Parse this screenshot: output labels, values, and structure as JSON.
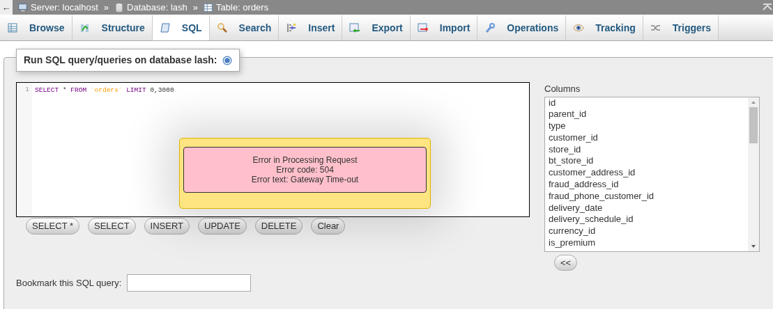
{
  "topbar": {
    "back": "←",
    "crumbs": [
      {
        "kind": "server",
        "label": "Server: localhost"
      },
      {
        "kind": "database",
        "label": "Database: lash"
      },
      {
        "kind": "table",
        "label": "Table: orders"
      }
    ],
    "separator": "»"
  },
  "tabs": [
    {
      "kind": "browse",
      "label": "Browse",
      "selected": false
    },
    {
      "kind": "structure",
      "label": "Structure",
      "selected": false
    },
    {
      "kind": "sql",
      "label": "SQL",
      "selected": true
    },
    {
      "kind": "search",
      "label": "Search",
      "selected": false
    },
    {
      "kind": "insert",
      "label": "Insert",
      "selected": false
    },
    {
      "kind": "export",
      "label": "Export",
      "selected": false
    },
    {
      "kind": "import",
      "label": "Import",
      "selected": false
    },
    {
      "kind": "operations",
      "label": "Operations",
      "selected": false
    },
    {
      "kind": "tracking",
      "label": "Tracking",
      "selected": false
    },
    {
      "kind": "triggers",
      "label": "Triggers",
      "selected": false
    }
  ],
  "legend": "Run SQL query/queries on database lash:",
  "editor": {
    "line_number": "1",
    "tokens": [
      {
        "text": "SELECT",
        "kind": "keyword"
      },
      {
        "text": "*",
        "kind": "plain"
      },
      {
        "text": "FROM",
        "kind": "keyword"
      },
      {
        "text": "`orders`",
        "kind": "identifier"
      },
      {
        "text": "LIMIT",
        "kind": "keyword"
      },
      {
        "text": "0,3000",
        "kind": "plain"
      }
    ]
  },
  "query_buttons": [
    "SELECT *",
    "SELECT",
    "INSERT",
    "UPDATE",
    "DELETE",
    "Clear"
  ],
  "columns": {
    "label": "Columns",
    "items": [
      "id",
      "parent_id",
      "type",
      "customer_id",
      "store_id",
      "bt_store_id",
      "customer_address_id",
      "fraud_address_id",
      "fraud_phone_customer_id",
      "delivery_date",
      "delivery_schedule_id",
      "currency_id",
      "is_premium"
    ],
    "insert_button": "<<"
  },
  "bookmark": {
    "label": "Bookmark this SQL query:"
  },
  "error": {
    "lines": [
      "Error in Processing Request",
      "Error code: 504",
      "Error text: Gateway Time-out"
    ]
  }
}
